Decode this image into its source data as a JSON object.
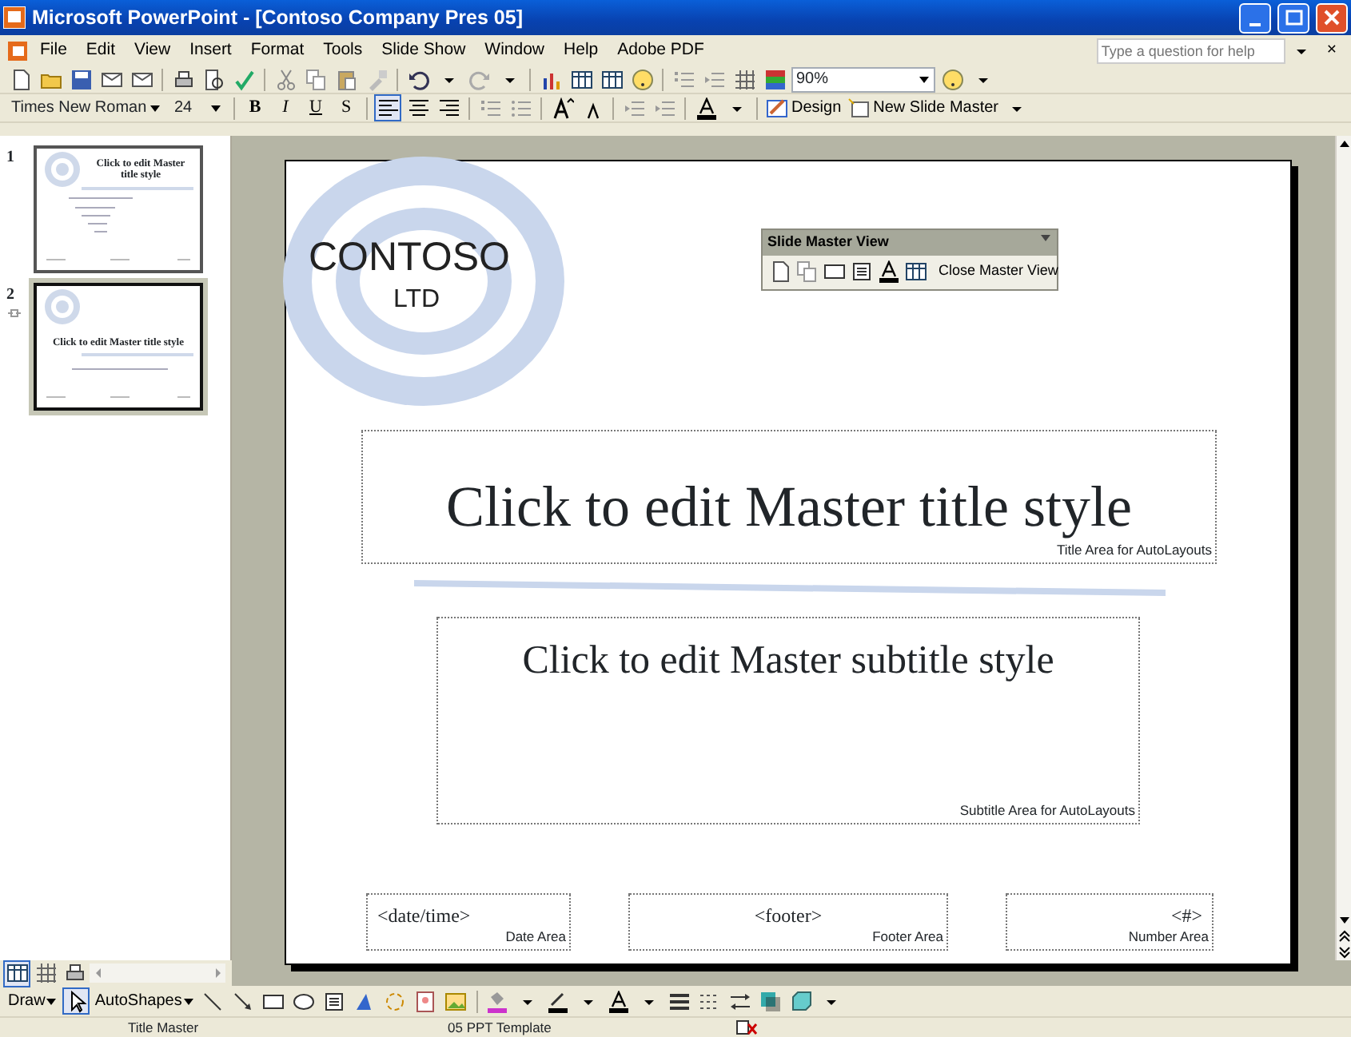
{
  "window": {
    "title": "Microsoft PowerPoint - [Contoso Company Pres 05]"
  },
  "menu": [
    "File",
    "Edit",
    "View",
    "Insert",
    "Format",
    "Tools",
    "Slide Show",
    "Window",
    "Help",
    "Adobe PDF"
  ],
  "help_box": {
    "placeholder": "Type a question for help"
  },
  "close_document": "×",
  "standard_toolbar": {
    "zoom": "90%"
  },
  "formatting_toolbar": {
    "font": "Times New Roman",
    "size": "24",
    "styles": [
      "B",
      "I",
      "U",
      "S"
    ],
    "align_buttons": [
      {
        "selected": true
      },
      {
        "selected": false
      },
      {
        "selected": false
      }
    ],
    "design": "Design",
    "new_master": "New Slide Master"
  },
  "thumbnails": [
    {
      "number": "1",
      "selected": false,
      "kind": "slide-master",
      "title": "Click to edit Master title style"
    },
    {
      "number": "2",
      "selected": true,
      "kind": "title-master",
      "title": "Click to edit Master title style"
    }
  ],
  "slide": {
    "logo": {
      "name": "CONTOSO",
      "suffix": "LTD"
    },
    "title": {
      "text": "Click to edit Master title style",
      "area": "Title Area for AutoLayouts"
    },
    "subtitle": {
      "text": "Click to edit Master subtitle style",
      "area": "Subtitle Area for AutoLayouts"
    },
    "footers": [
      {
        "text": "<date/time>",
        "area": "Date Area",
        "kind": "date"
      },
      {
        "text": "<footer>",
        "area": "Footer Area",
        "kind": "footer"
      },
      {
        "text": "<#>",
        "area": "Number Area",
        "kind": "number"
      }
    ]
  },
  "master_toolbar": {
    "title": "Slide Master View",
    "close": "Close Master View"
  },
  "drawing_toolbar": {
    "draw": "Draw",
    "autoshapes": "AutoShapes"
  },
  "status_bar": [
    "Title Master",
    "05 PPT Template"
  ]
}
